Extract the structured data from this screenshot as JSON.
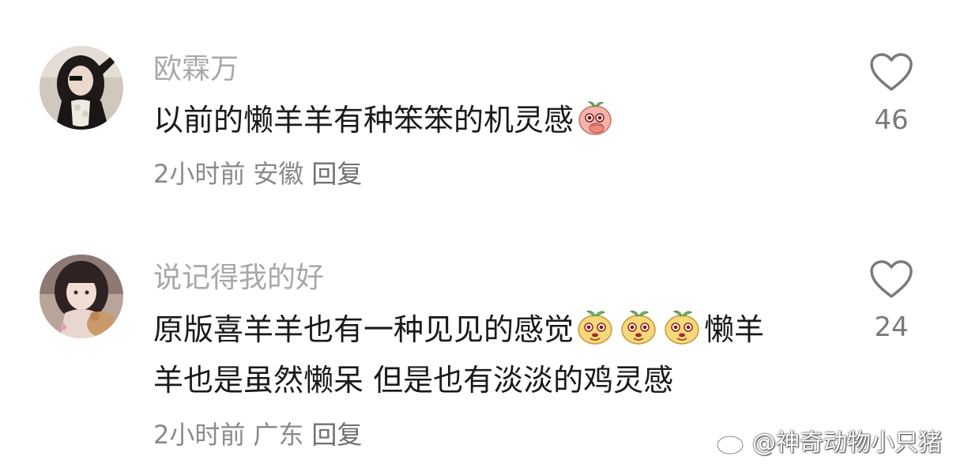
{
  "comments": [
    {
      "username": "欧霖万",
      "text": "以前的懒羊羊有种笨笨的机灵感",
      "time": "2小时前",
      "location": "安徽",
      "reply_label": "回复",
      "likes": "46",
      "emojis": [
        "peach-cover-face-emoji"
      ]
    },
    {
      "username": "说记得我的好",
      "text_line1_a": "原版喜羊羊也有一种见见的感觉",
      "text_line1_b": "懒羊",
      "text_line2": "羊也是虽然懒呆 但是也有淡淡的鸡灵感",
      "time": "2小时前",
      "location": "广东",
      "reply_label": "回复",
      "likes": "24",
      "emojis": [
        "yellow-blob-emoji",
        "yellow-blob-emoji",
        "yellow-blob-emoji"
      ]
    }
  ],
  "watermark": "@神奇动物小只猪",
  "icons": {
    "like": "heart-outline-icon",
    "watermark": "weibo-logo-icon"
  },
  "colors": {
    "username": "#a8a8a8",
    "text": "#1a1a1a",
    "meta": "#8a8a8a"
  }
}
